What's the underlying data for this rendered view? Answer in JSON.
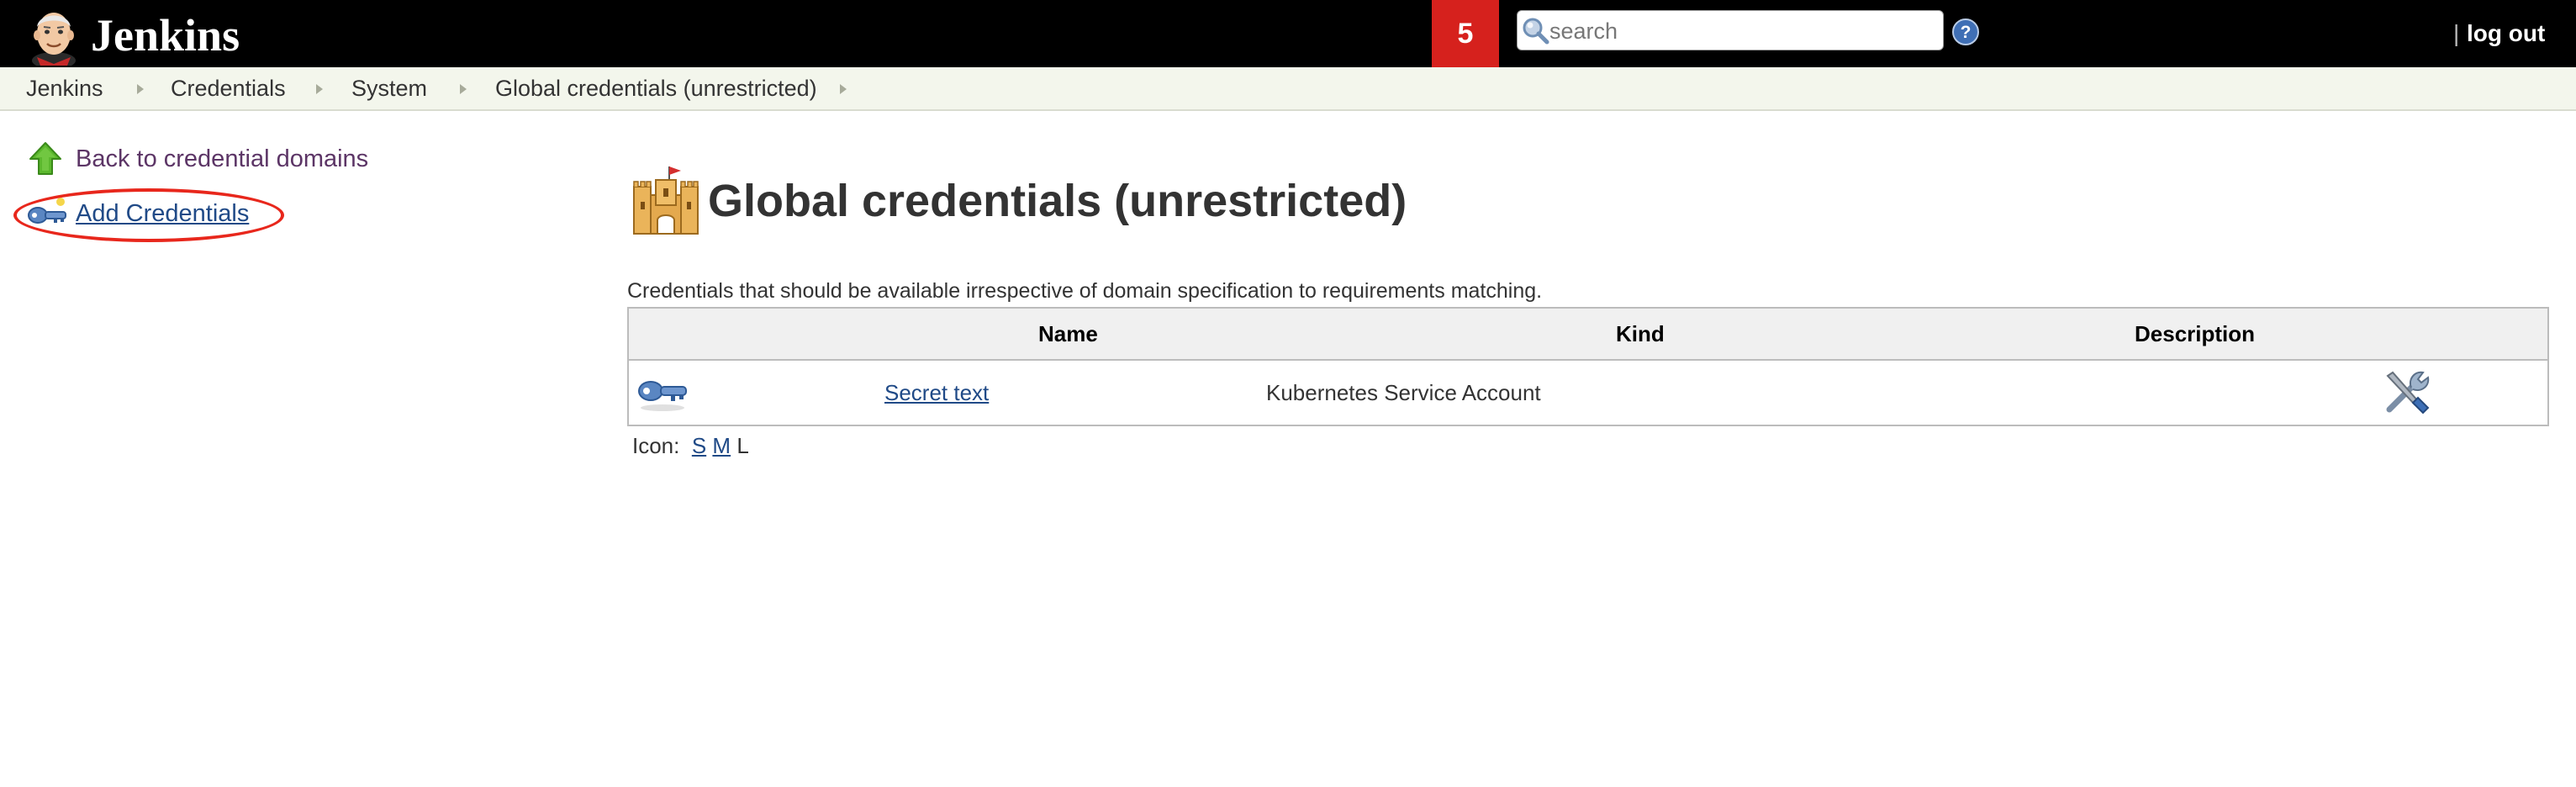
{
  "header": {
    "app_name": "Jenkins",
    "notification_count": "5",
    "search_placeholder": "search",
    "separator": "|",
    "logout_label": "log out"
  },
  "breadcrumb": [
    "Jenkins",
    "Credentials",
    "System",
    "Global credentials (unrestricted)"
  ],
  "sidebar": {
    "items": [
      {
        "label": "Back to credential domains",
        "icon": "up-arrow-icon"
      },
      {
        "label": "Add Credentials",
        "icon": "key-icon",
        "highlighted": true
      }
    ]
  },
  "main": {
    "title": "Global credentials (unrestricted)",
    "title_icon": "castle-icon",
    "description": "Credentials that should be available irrespective of domain specification to requirements matching.",
    "table": {
      "columns": [
        "Name",
        "Kind",
        "Description"
      ],
      "rows": [
        {
          "icon": "key-icon",
          "name": "Secret text",
          "kind": "Kubernetes Service Account",
          "description": "",
          "action_icon": "configure-tools-icon"
        }
      ]
    },
    "icon_size": {
      "label": "Icon:",
      "options": [
        "S",
        "M",
        "L"
      ],
      "selected": "L"
    }
  },
  "colors": {
    "header_bg": "#000000",
    "notification_bg": "#d6211d",
    "breadcrumb_bg": "#f3f6ec",
    "link": "#204a87",
    "visited_link": "#5c3566",
    "highlight": "#e8271c"
  }
}
